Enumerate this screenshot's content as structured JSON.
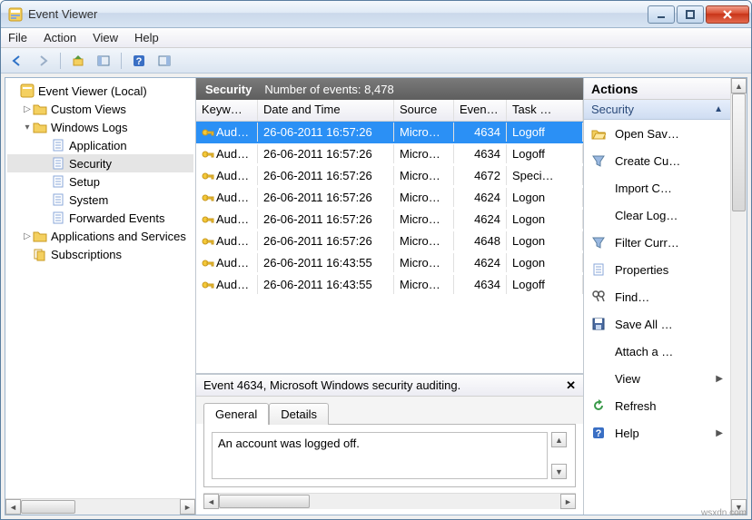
{
  "titlebar": {
    "title": "Event Viewer"
  },
  "menu": {
    "file": "File",
    "action": "Action",
    "view": "View",
    "help": "Help"
  },
  "tree": {
    "root": "Event Viewer (Local)",
    "custom_views": "Custom Views",
    "windows_logs": "Windows Logs",
    "application": "Application",
    "security": "Security",
    "setup": "Setup",
    "system": "System",
    "forwarded": "Forwarded Events",
    "apps_services": "Applications and Services",
    "subscriptions": "Subscriptions"
  },
  "list_header": {
    "title": "Security",
    "count_label": "Number of events: 8,478"
  },
  "columns": {
    "keywords": "Keyw…",
    "datetime": "Date and Time",
    "source": "Source",
    "eventid": "Event…",
    "task": "Task …"
  },
  "events": [
    {
      "keywords": "Aud…",
      "datetime": "26-06-2011 16:57:26",
      "source": "Micro…",
      "eventid": "4634",
      "task": "Logoff",
      "selected": true
    },
    {
      "keywords": "Aud…",
      "datetime": "26-06-2011 16:57:26",
      "source": "Micro…",
      "eventid": "4634",
      "task": "Logoff"
    },
    {
      "keywords": "Aud…",
      "datetime": "26-06-2011 16:57:26",
      "source": "Micro…",
      "eventid": "4672",
      "task": "Speci…"
    },
    {
      "keywords": "Aud…",
      "datetime": "26-06-2011 16:57:26",
      "source": "Micro…",
      "eventid": "4624",
      "task": "Logon"
    },
    {
      "keywords": "Aud…",
      "datetime": "26-06-2011 16:57:26",
      "source": "Micro…",
      "eventid": "4624",
      "task": "Logon"
    },
    {
      "keywords": "Aud…",
      "datetime": "26-06-2011 16:57:26",
      "source": "Micro…",
      "eventid": "4648",
      "task": "Logon"
    },
    {
      "keywords": "Aud…",
      "datetime": "26-06-2011 16:43:55",
      "source": "Micro…",
      "eventid": "4624",
      "task": "Logon"
    },
    {
      "keywords": "Aud…",
      "datetime": "26-06-2011 16:43:55",
      "source": "Micro…",
      "eventid": "4634",
      "task": "Logoff"
    }
  ],
  "detail": {
    "title": "Event 4634, Microsoft Windows security auditing.",
    "tabs": {
      "general": "General",
      "details": "Details"
    },
    "message": "An account was logged off."
  },
  "actions": {
    "header": "Actions",
    "section": "Security",
    "items": [
      {
        "icon": "folder-open",
        "label": "Open Sav…"
      },
      {
        "icon": "funnel-create",
        "label": "Create Cu…"
      },
      {
        "icon": "blank",
        "label": "Import C…"
      },
      {
        "icon": "blank",
        "label": "Clear Log…"
      },
      {
        "icon": "funnel",
        "label": "Filter Curr…"
      },
      {
        "icon": "properties",
        "label": "Properties"
      },
      {
        "icon": "find",
        "label": "Find…"
      },
      {
        "icon": "save",
        "label": "Save All …"
      },
      {
        "icon": "blank",
        "label": "Attach a …"
      },
      {
        "icon": "blank",
        "label": "View",
        "submenu": true
      },
      {
        "icon": "refresh",
        "label": "Refresh"
      },
      {
        "icon": "help",
        "label": "Help",
        "submenu": true
      }
    ]
  },
  "watermark": "wsxdn.com"
}
